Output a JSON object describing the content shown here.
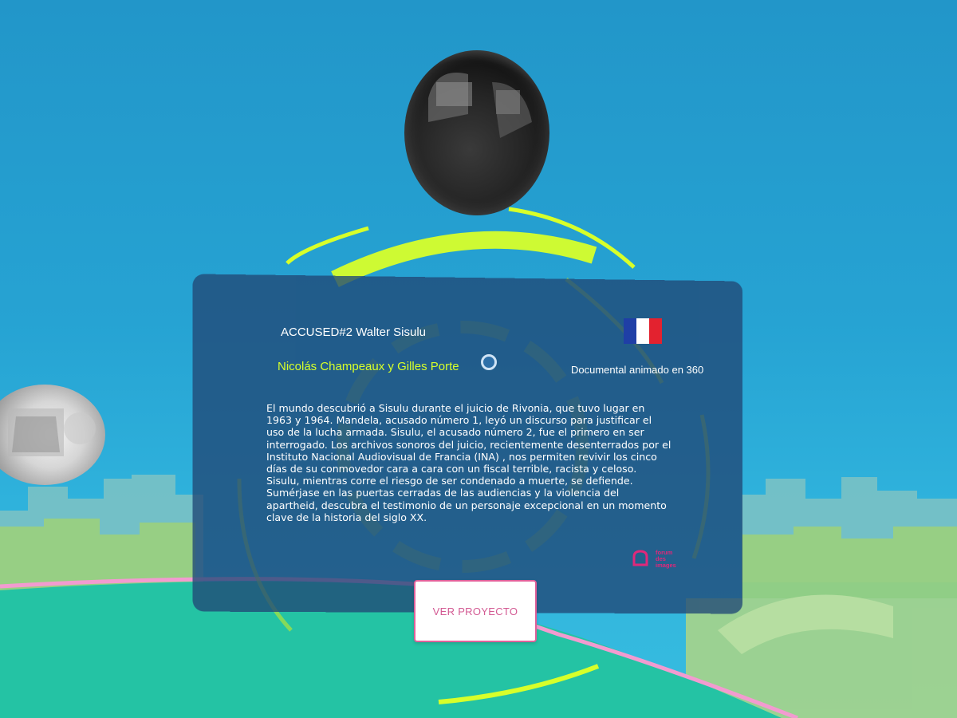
{
  "card": {
    "title": "ACCUSED#2 Walter Sisulu",
    "authors": "Nicolás Champeaux y Gilles Porte",
    "type": "Documental animado en 360",
    "description": "El mundo descubrió a Sisulu durante el juicio de Rivonia, que tuvo lugar en 1963 y 1964. Mandela, acusado número 1, leyó un discurso para justificar el uso de la lucha armada. Sisulu, el acusado número 2, fue el primero en ser interrogado. Los archivos sonoros del juicio, recientemente desenterrados por el Instituto Nacional Audiovisual de Francia (INA) , nos permiten revivir los cinco días de su conmovedor cara a cara con un fiscal terrible, racista y celoso. Sisulu, mientras corre el riesgo de ser condenado a muerte, se defiende. Sumérjase en las puertas cerradas de las audiencias y la violencia del apartheid, descubra el testimonio de un personaje excepcional en un momento clave de la historia del siglo XX.",
    "cta_label": "VER PROYECTO",
    "country_flag_icon": "france-flag-icon",
    "flag_colors": [
      "#1f3fa6",
      "#ffffff",
      "#e3222f"
    ]
  },
  "logo": {
    "icon": "forum-des-images-logo",
    "lines": [
      "forum",
      "des",
      "images"
    ],
    "color": "#e0287a"
  },
  "theme": {
    "accent": "#d7ff2a",
    "panel": "#204876",
    "cta_border": "#e0609a"
  }
}
